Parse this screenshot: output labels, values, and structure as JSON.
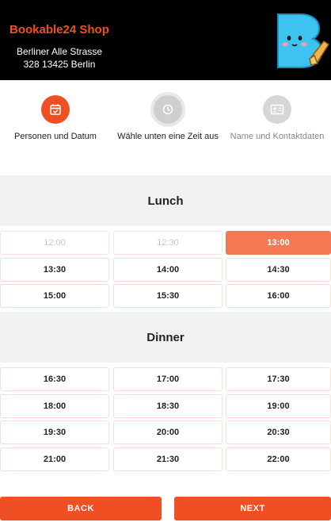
{
  "header": {
    "shop_name": "Bookable24 Shop",
    "address_line1": "Berliner Alle Strasse",
    "address_line2": "328 13425 Berlin",
    "logo_icon": "bookable-b-mascot-icon"
  },
  "steps": [
    {
      "label": "Personen und Datum",
      "icon": "calendar-check-icon",
      "state": "done"
    },
    {
      "label": "Wähle unten eine Zeit aus",
      "icon": "clock-icon",
      "state": "current"
    },
    {
      "label": "Name und Kontaktdaten",
      "icon": "id-card-icon",
      "state": "pending"
    }
  ],
  "lunch": {
    "title": "Lunch",
    "slots": [
      {
        "time": "12:00",
        "state": "disabled"
      },
      {
        "time": "12:30",
        "state": "disabled"
      },
      {
        "time": "13:00",
        "state": "selected"
      },
      {
        "time": "13:30",
        "state": "available"
      },
      {
        "time": "14:00",
        "state": "available"
      },
      {
        "time": "14:30",
        "state": "available"
      },
      {
        "time": "15:00",
        "state": "available"
      },
      {
        "time": "15:30",
        "state": "available"
      },
      {
        "time": "16:00",
        "state": "available"
      }
    ]
  },
  "dinner": {
    "title": "Dinner",
    "slots": [
      {
        "time": "16:30",
        "state": "available"
      },
      {
        "time": "17:00",
        "state": "available"
      },
      {
        "time": "17:30",
        "state": "available"
      },
      {
        "time": "18:00",
        "state": "available"
      },
      {
        "time": "18:30",
        "state": "available"
      },
      {
        "time": "19:00",
        "state": "available"
      },
      {
        "time": "19:30",
        "state": "available"
      },
      {
        "time": "20:00",
        "state": "available"
      },
      {
        "time": "20:30",
        "state": "available"
      },
      {
        "time": "21:00",
        "state": "available"
      },
      {
        "time": "21:30",
        "state": "available"
      },
      {
        "time": "22:00",
        "state": "available"
      }
    ]
  },
  "buttons": {
    "back_label": "BACK",
    "next_label": "NEXT"
  },
  "colors": {
    "accent": "#f04f24",
    "selected_slot": "#f47853",
    "header_bg": "#000000"
  }
}
